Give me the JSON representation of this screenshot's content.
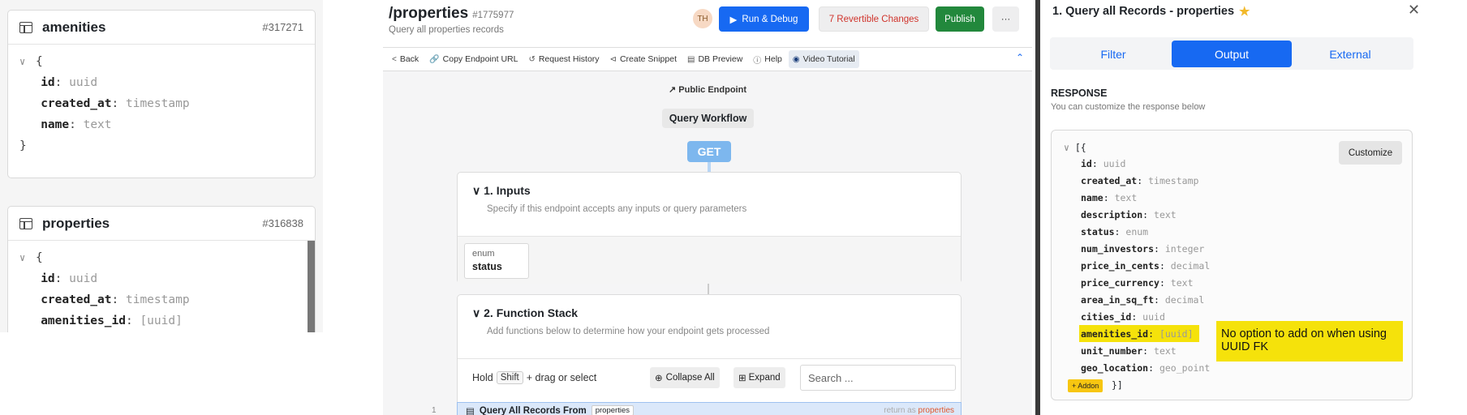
{
  "schema": {
    "amenities": {
      "name": "amenities",
      "id": "#317271",
      "open": "{",
      "close": "}",
      "fields": [
        {
          "k": "id",
          "t": "uuid"
        },
        {
          "k": "created_at",
          "t": "timestamp"
        },
        {
          "k": "name",
          "t": "text"
        }
      ]
    },
    "properties": {
      "name": "properties",
      "id": "#316838",
      "open": "{",
      "fields": [
        {
          "k": "id",
          "t": "uuid"
        },
        {
          "k": "created_at",
          "t": "timestamp"
        },
        {
          "k": "amenities_id",
          "t": "[uuid]"
        }
      ]
    }
  },
  "header": {
    "title": "/properties",
    "hash": "#1775977",
    "subtitle": "Query all properties records",
    "avatar": "TH",
    "run": "Run & Debug",
    "revertible": "7 Revertible Changes",
    "publish": "Publish",
    "more": "···"
  },
  "toolbar": {
    "back": "Back",
    "copy": "Copy Endpoint URL",
    "history": "Request History",
    "snippet": "Create Snippet",
    "db": "DB Preview",
    "help": "Help",
    "video": "Video Tutorial"
  },
  "canvas": {
    "public": "Public Endpoint",
    "workflow": "Query Workflow",
    "method": "GET",
    "inputs": {
      "title": "1. Inputs",
      "desc": "Specify if this endpoint accepts any inputs or query parameters",
      "chip_type": "enum",
      "chip_name": "status"
    },
    "stack": {
      "title": "2. Function Stack",
      "desc": "Add functions below to determine how your endpoint gets processed",
      "hold": "Hold",
      "shift": "Shift",
      "drag": "+ drag or select",
      "collapse": "Collapse All",
      "expand": "Expand",
      "search_placeholder": "Search ..."
    },
    "fn": {
      "line": "1",
      "label": "Query All Records From",
      "table": "properties",
      "return_prefix": "return as",
      "return_var": "properties"
    }
  },
  "panel": {
    "title": "1. Query all Records - properties",
    "tabs": [
      "Filter",
      "Output",
      "External"
    ],
    "active_tab": "Output",
    "response_title": "RESPONSE",
    "response_desc": "You can customize the response below",
    "customize": "Customize",
    "open": "[{",
    "close": "}]",
    "addon": "+ Addon",
    "fields": [
      {
        "k": "id",
        "t": "uuid"
      },
      {
        "k": "created_at",
        "t": "timestamp"
      },
      {
        "k": "name",
        "t": "text"
      },
      {
        "k": "description",
        "t": "text"
      },
      {
        "k": "status",
        "t": "enum"
      },
      {
        "k": "num_investors",
        "t": "integer"
      },
      {
        "k": "price_in_cents",
        "t": "decimal"
      },
      {
        "k": "price_currency",
        "t": "text"
      },
      {
        "k": "area_in_sq_ft",
        "t": "decimal"
      },
      {
        "k": "cities_id",
        "t": "uuid"
      },
      {
        "k": "amenities_id",
        "t": "[uuid]"
      },
      {
        "k": "unit_number",
        "t": "text"
      },
      {
        "k": "geo_location",
        "t": "geo_point"
      }
    ],
    "note": "No option to add on when using UUID FK"
  }
}
